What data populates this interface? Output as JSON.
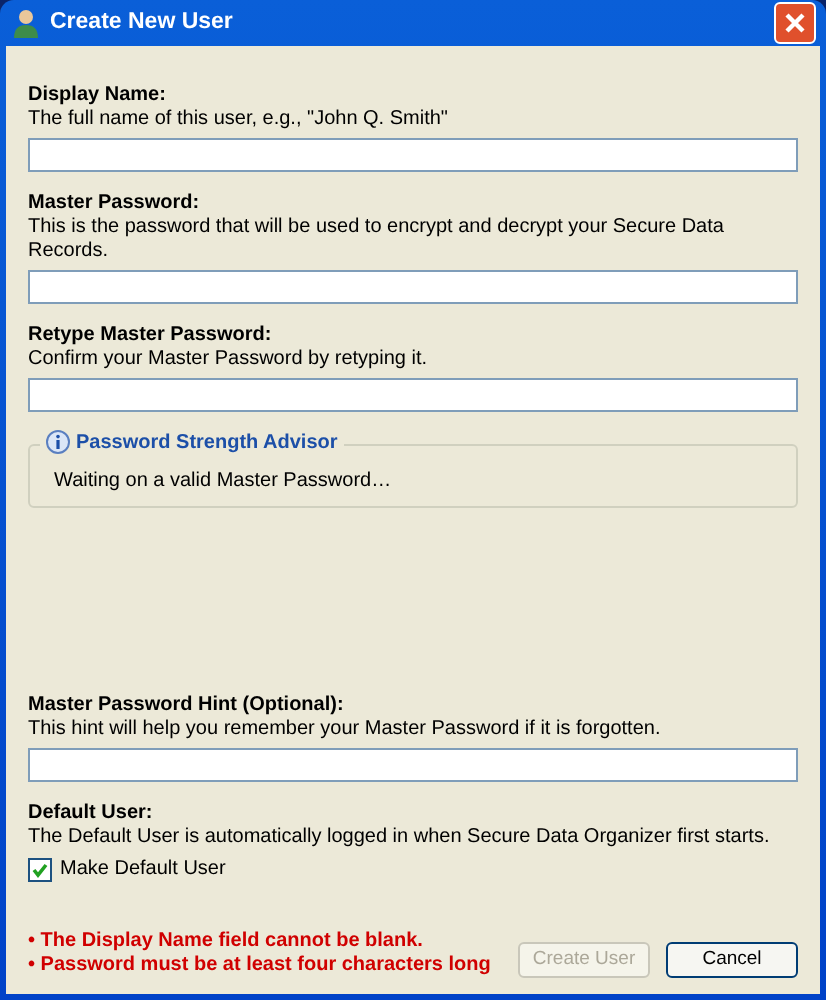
{
  "window": {
    "title": "Create New User"
  },
  "sections": [
    {
      "kind": "field",
      "label": "Display Name:",
      "description": "The full name of this user, e.g., \"John Q. Smith\""
    },
    {
      "kind": "field",
      "label": "Master Password:",
      "description": "This is the password that will be used to encrypt and decrypt your Secure Data Records."
    },
    {
      "kind": "field",
      "label": "Retype Master Password:",
      "description": "Confirm your Master Password by retyping it."
    },
    {
      "kind": "advisor",
      "label": "Password Strength Advisor",
      "description": "Waiting on a valid Master Password…"
    },
    {
      "kind": "field",
      "label": "Master Password Hint (Optional):",
      "description": "This hint will help you remember your Master Password if it is forgotten."
    },
    {
      "kind": "checkbox",
      "label": "Default User:",
      "description": "The Default User is automatically logged in when Secure Data Organizer first starts.",
      "option": "Make Default User",
      "checked": true
    }
  ],
  "errors": [
    "• The Display Name field cannot be blank.",
    "• Password must be at least four characters long"
  ],
  "buttons": [
    {
      "label": "Create User",
      "disabled": true
    },
    {
      "label": "Cancel",
      "disabled": false
    }
  ]
}
